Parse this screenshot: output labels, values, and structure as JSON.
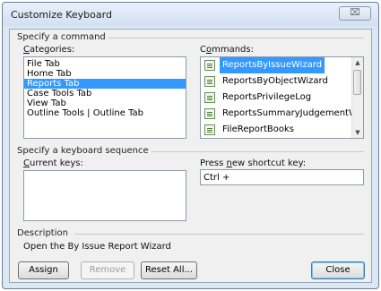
{
  "window": {
    "title": "Customize Keyboard",
    "close_glyph": "⌧"
  },
  "command_section": {
    "label": "Specify a command",
    "categories_label": "Categories:",
    "categories": [
      "File Tab",
      "Home Tab",
      "Reports Tab",
      "Case Tools Tab",
      "View Tab",
      "Outline Tools | Outline Tab"
    ],
    "selected_category": "Reports Tab",
    "commands_label": "Commands:",
    "commands": [
      {
        "label": "ReportsByIssueWizard",
        "icon": "report-icon"
      },
      {
        "label": "ReportsByObjectWizard",
        "icon": "report-icon"
      },
      {
        "label": "ReportsPrivilegeLog",
        "icon": "report-icon"
      },
      {
        "label": "ReportsSummaryJudgementWizard",
        "icon": "report-icon"
      },
      {
        "label": "FileReportBooks",
        "icon": "report-icon"
      }
    ],
    "selected_command": "ReportsByIssueWizard"
  },
  "keyboard_section": {
    "label": "Specify a keyboard sequence",
    "current_keys_label": "Current keys:",
    "current_keys": "",
    "new_shortcut_label": "Press new shortcut key:",
    "new_shortcut_value": "Ctrl +"
  },
  "description": {
    "label": "Description",
    "text": "Open the By Issue Report Wizard"
  },
  "buttons": {
    "assign": "Assign",
    "remove": "Remove",
    "reset_all": "Reset All...",
    "close": "Close"
  }
}
